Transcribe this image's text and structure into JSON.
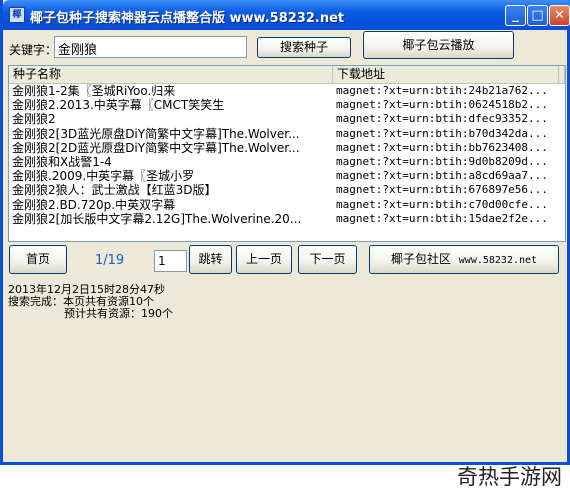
{
  "window": {
    "title": "椰子包种子搜索神器云点播整合版 www.58232.net",
    "minimize": "_",
    "maximize": "□",
    "close": "✕"
  },
  "search": {
    "keyword_label": "关键字：",
    "keyword_value": "金刚狼",
    "search_button": "搜索种子",
    "cloud_play_button": "椰子包云播放"
  },
  "table": {
    "columns": [
      "种子名称",
      "下载地址"
    ],
    "rows": [
      {
        "name": "金刚狼1-2集〖圣城RiYoo.归来",
        "link": "magnet:?xt=urn:btih:24b21a762..."
      },
      {
        "name": "金刚狼2.2013.中英字幕〖CMCT笑笑生",
        "link": "magnet:?xt=urn:btih:0624518b2..."
      },
      {
        "name": "金刚狼2",
        "link": "magnet:?xt=urn:btih:dfec93352..."
      },
      {
        "name": "金刚狼2[3D蓝光原盘DiY简繁中文字幕]The.Wolver...",
        "link": "magnet:?xt=urn:btih:b70d342da..."
      },
      {
        "name": "金刚狼2[2D蓝光原盘DiY简繁中文字幕]The.Wolver...",
        "link": "magnet:?xt=urn:btih:bb7623408..."
      },
      {
        "name": "金刚狼和X战警1-4",
        "link": "magnet:?xt=urn:btih:9d0b8209d..."
      },
      {
        "name": "金刚狼.2009.中英字幕〖圣城小罗",
        "link": "magnet:?xt=urn:btih:a8cd69aa7..."
      },
      {
        "name": "金刚狼2狼人：武士激战【红蓝3D版】",
        "link": "magnet:?xt=urn:btih:676897e56..."
      },
      {
        "name": "金刚狼2.BD.720p.中英双字幕",
        "link": "magnet:?xt=urn:btih:c70d00cfe..."
      },
      {
        "name": "金刚狼2[加长版中文字幕2.12G]The.Wolverine.20...",
        "link": "magnet:?xt=urn:btih:15dae2f2e..."
      }
    ]
  },
  "pager": {
    "first": "首页",
    "page_indicator": "1/19",
    "page_input": "1",
    "jump": "跳转",
    "prev": "上一页",
    "next": "下一页",
    "community": "椰子包社区",
    "community_url": "www.58232.net"
  },
  "status": {
    "timestamp": "2013年12月2日15时28分47秒",
    "line1": "搜索完成：本页共有资源10个",
    "line2": "预计共有资源：190个"
  },
  "watermark": "奇热手游网"
}
